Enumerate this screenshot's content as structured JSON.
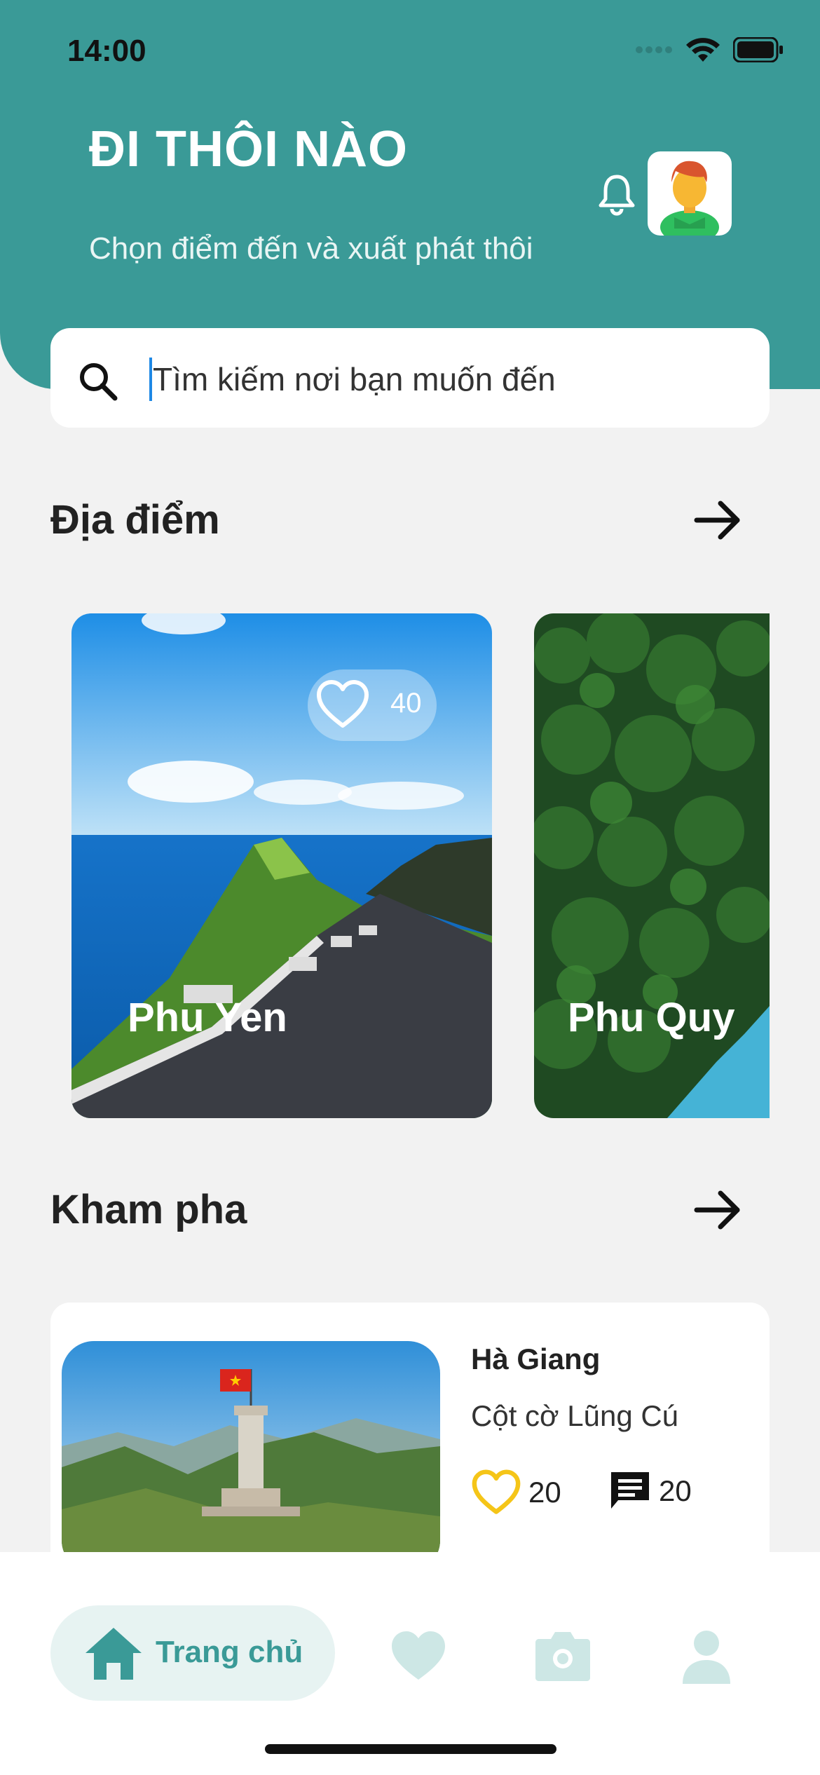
{
  "status_bar": {
    "time": "14:00"
  },
  "header": {
    "title": "ĐI THÔI NÀO",
    "subtitle": "Chọn điểm đến và xuất phát thôi"
  },
  "search": {
    "placeholder": "Tìm kiếm nơi bạn muốn đến"
  },
  "places_section": {
    "title": "Địa điểm",
    "cards": [
      {
        "name": "Phu Yen",
        "likes": "40"
      },
      {
        "name": "Phu Quy"
      }
    ]
  },
  "explore_section": {
    "title": "Kham pha",
    "items": [
      {
        "province": "Hà Giang",
        "place": "Cột cờ Lũng Cú",
        "likes": "20",
        "comments": "20"
      }
    ]
  },
  "bottom_nav": {
    "home_label": "Trang chủ"
  },
  "colors": {
    "primary": "#3a9a97",
    "background": "#f2f2f2",
    "like_yellow": "#f5c518",
    "nav_inactive": "#cde7e5"
  },
  "icons": [
    "bell-icon",
    "search-icon",
    "arrow-right-icon",
    "heart-icon",
    "comment-icon",
    "home-icon",
    "camera-icon",
    "user-icon"
  ]
}
